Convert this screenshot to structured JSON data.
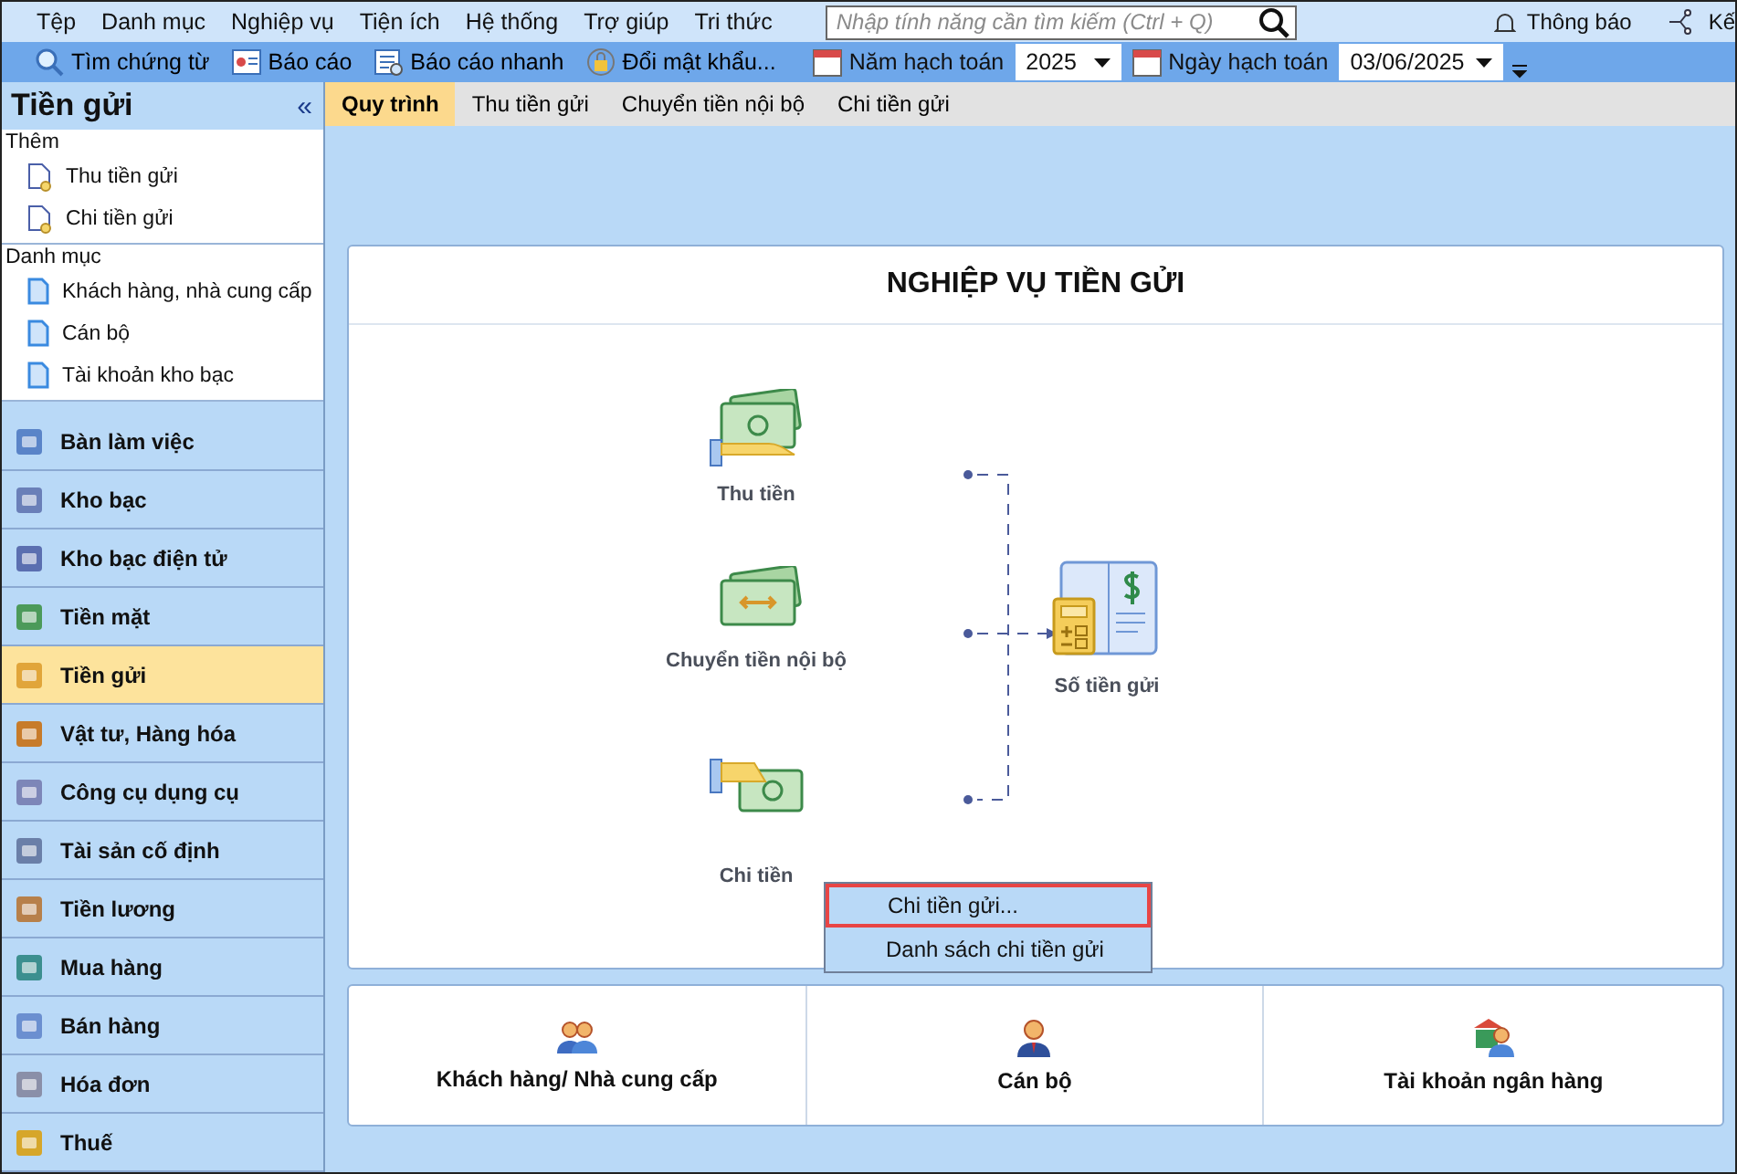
{
  "menu": [
    "Tệp",
    "Danh mục",
    "Nghiệp vụ",
    "Tiện ích",
    "Hệ thống",
    "Trợ giúp",
    "Tri thức"
  ],
  "search": {
    "placeholder": "Nhập tính năng cần tìm kiếm (Ctrl + Q)"
  },
  "notifications": "Thông báo",
  "connect": "Kế",
  "toolbar": [
    {
      "label": "Tìm chứng từ",
      "kind": "search"
    },
    {
      "label": "Báo cáo",
      "kind": "report"
    },
    {
      "label": "Báo cáo nhanh",
      "kind": "quick"
    },
    {
      "label": "Đổi mật khẩu...",
      "kind": "password"
    }
  ],
  "year": {
    "label": "Năm hạch toán",
    "value": "2025"
  },
  "date": {
    "label": "Ngày hạch toán",
    "value": "03/06/2025"
  },
  "sidebar": {
    "title": "Tiền gửi",
    "collapse": "«",
    "groups": [
      {
        "title": "Thêm",
        "kind": "add",
        "items": [
          "Thu tiền gửi",
          "Chi tiền gửi"
        ]
      },
      {
        "title": "Danh mục",
        "kind": "list",
        "items": [
          "Khách hàng, nhà cung cấp",
          "Cán bộ",
          "Tài khoản kho bạc"
        ]
      }
    ],
    "nav": [
      {
        "label": "Bàn làm việc",
        "kind": "desk",
        "selected": false
      },
      {
        "label": "Kho bạc",
        "kind": "bank",
        "selected": false
      },
      {
        "label": "Kho bạc điện tử",
        "kind": "ebank",
        "selected": false
      },
      {
        "label": "Tiền mặt",
        "kind": "cash",
        "selected": false
      },
      {
        "label": "Tiền gửi",
        "kind": "deposit",
        "selected": true
      },
      {
        "label": "Vật tư, Hàng hóa",
        "kind": "goods",
        "selected": false
      },
      {
        "label": "Công cụ dụng cụ",
        "kind": "tools",
        "selected": false
      },
      {
        "label": "Tài sản cố định",
        "kind": "assets",
        "selected": false
      },
      {
        "label": "Tiền lương",
        "kind": "salary",
        "selected": false
      },
      {
        "label": "Mua hàng",
        "kind": "buy",
        "selected": false
      },
      {
        "label": "Bán hàng",
        "kind": "sell",
        "selected": false
      },
      {
        "label": "Hóa đơn",
        "kind": "invoice",
        "selected": false
      },
      {
        "label": "Thuế",
        "kind": "tax",
        "selected": false
      }
    ]
  },
  "tabs": [
    {
      "label": "Quy trình",
      "selected": true
    },
    {
      "label": "Thu tiền gửi",
      "selected": false
    },
    {
      "label": "Chuyển tiền nội bộ",
      "selected": false
    },
    {
      "label": "Chi tiền gửi",
      "selected": false
    }
  ],
  "process": {
    "title": "NGHIỆP VỤ TIỀN GỬI",
    "nodes": [
      {
        "label": "Thu tiền",
        "kind": "receive"
      },
      {
        "label": "Chuyển tiền nội bộ",
        "kind": "transfer"
      },
      {
        "label": "Chi tiền",
        "kind": "pay"
      },
      {
        "label": "Số tiền gửi",
        "kind": "book"
      }
    ],
    "popup": [
      {
        "label": "Chi tiền gửi...",
        "selected": true
      },
      {
        "label": "Danh sách chi tiền gửi",
        "selected": false
      }
    ]
  },
  "shortcuts": [
    {
      "label": "Khách hàng/ Nhà cung cấp",
      "kind": "partners"
    },
    {
      "label": "Cán bộ",
      "kind": "staff"
    },
    {
      "label": "Tài khoản ngân hàng",
      "kind": "bankaccount"
    }
  ]
}
